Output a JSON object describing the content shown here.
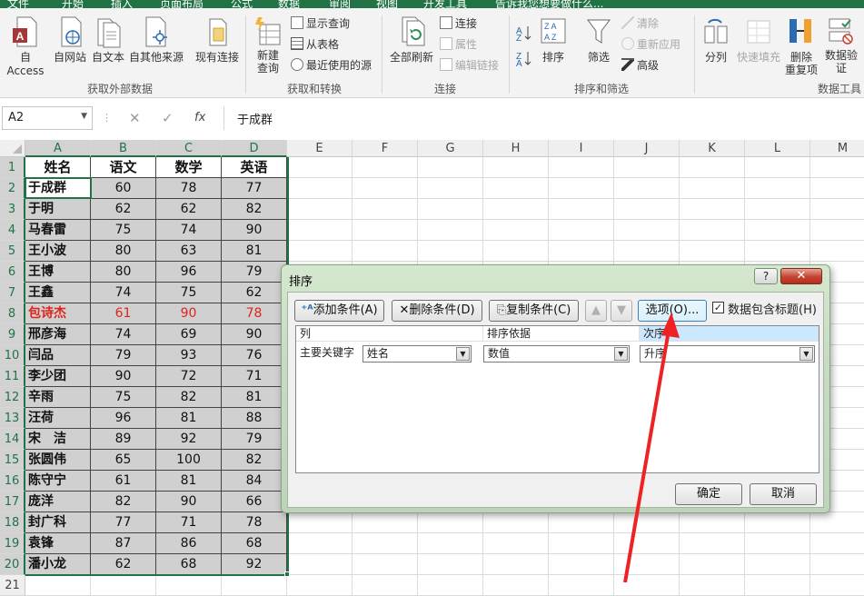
{
  "tabs": [
    "文件",
    "开始",
    "插入",
    "页面布局",
    "公式",
    "数据",
    "审阅",
    "视图",
    "开发工具",
    "告诉我您想要做什么..."
  ],
  "ribbon": {
    "external": {
      "access": "自 Access",
      "web": "自网站",
      "text": "自文本",
      "other": "自其他来源",
      "existing": "现有连接",
      "group": "获取外部数据"
    },
    "transform": {
      "new_query_1": "新建",
      "new_query_2": "查询",
      "show_query": "显示查询",
      "from_table": "从表格",
      "recent": "最近使用的源",
      "group": "获取和转换"
    },
    "connections": {
      "refresh_all": "全部刷新",
      "connections": "连接",
      "properties": "属性",
      "edit_links": "编辑链接",
      "group": "连接"
    },
    "sortfilter": {
      "sort": "排序",
      "filter": "筛选",
      "clear": "清除",
      "reapply": "重新应用",
      "advanced": "高级",
      "group": "排序和筛选"
    },
    "tools": {
      "split": "分列",
      "flash_fill": "快速填充",
      "remove_dup_1": "删除",
      "remove_dup_2": "重复项",
      "validate_1": "数据验",
      "validate_2": "证",
      "group": "数据工具"
    }
  },
  "formula_bar": {
    "name_box": "A2",
    "formula": "于成群",
    "fx": "fx"
  },
  "columns": [
    "A",
    "B",
    "C",
    "D",
    "E",
    "F",
    "G",
    "H",
    "I",
    "J",
    "K",
    "L",
    "M"
  ],
  "table": {
    "headers": [
      "姓名",
      "语文",
      "数学",
      "英语"
    ],
    "rows": [
      [
        "于成群",
        "60",
        "78",
        "77"
      ],
      [
        "于明",
        "62",
        "62",
        "82"
      ],
      [
        "马春雷",
        "75",
        "74",
        "90"
      ],
      [
        "王小波",
        "80",
        "63",
        "81"
      ],
      [
        "王博",
        "80",
        "96",
        "79"
      ],
      [
        "王鑫",
        "74",
        "75",
        "62"
      ],
      [
        "包诗杰",
        "61",
        "90",
        "78"
      ],
      [
        "邢彦海",
        "74",
        "69",
        "90"
      ],
      [
        "闫品",
        "79",
        "93",
        "76"
      ],
      [
        "李少团",
        "90",
        "72",
        "71"
      ],
      [
        "辛雨",
        "75",
        "82",
        "81"
      ],
      [
        "汪荷",
        "96",
        "81",
        "88"
      ],
      [
        "宋　洁",
        "89",
        "92",
        "79"
      ],
      [
        "张圆伟",
        "65",
        "100",
        "82"
      ],
      [
        "陈守宁",
        "61",
        "81",
        "84"
      ],
      [
        "庞洋",
        "82",
        "90",
        "66"
      ],
      [
        "封广科",
        "77",
        "71",
        "78"
      ],
      [
        "袁锋",
        "87",
        "86",
        "68"
      ],
      [
        "潘小龙",
        "62",
        "68",
        "92"
      ]
    ],
    "highlight_row": 6,
    "highlight_color": "#e0231b"
  },
  "dialog": {
    "title": "排序",
    "help": "?",
    "close": "✕",
    "add_condition": "添加条件(A)",
    "delete_condition": "删除条件(D)",
    "copy_condition": "复制条件(C)",
    "options": "选项(O)...",
    "has_headers": "数据包含标题(H)",
    "col_header": "列",
    "sort_on_header": "排序依据",
    "order_header": "次序",
    "row_label": "主要关键字",
    "column_value": "姓名",
    "sort_on_value": "数值",
    "order_value": "升序",
    "ok": "确定",
    "cancel": "取消"
  },
  "colors": {
    "excel_green": "#217346",
    "arrow": "#ee2222"
  }
}
